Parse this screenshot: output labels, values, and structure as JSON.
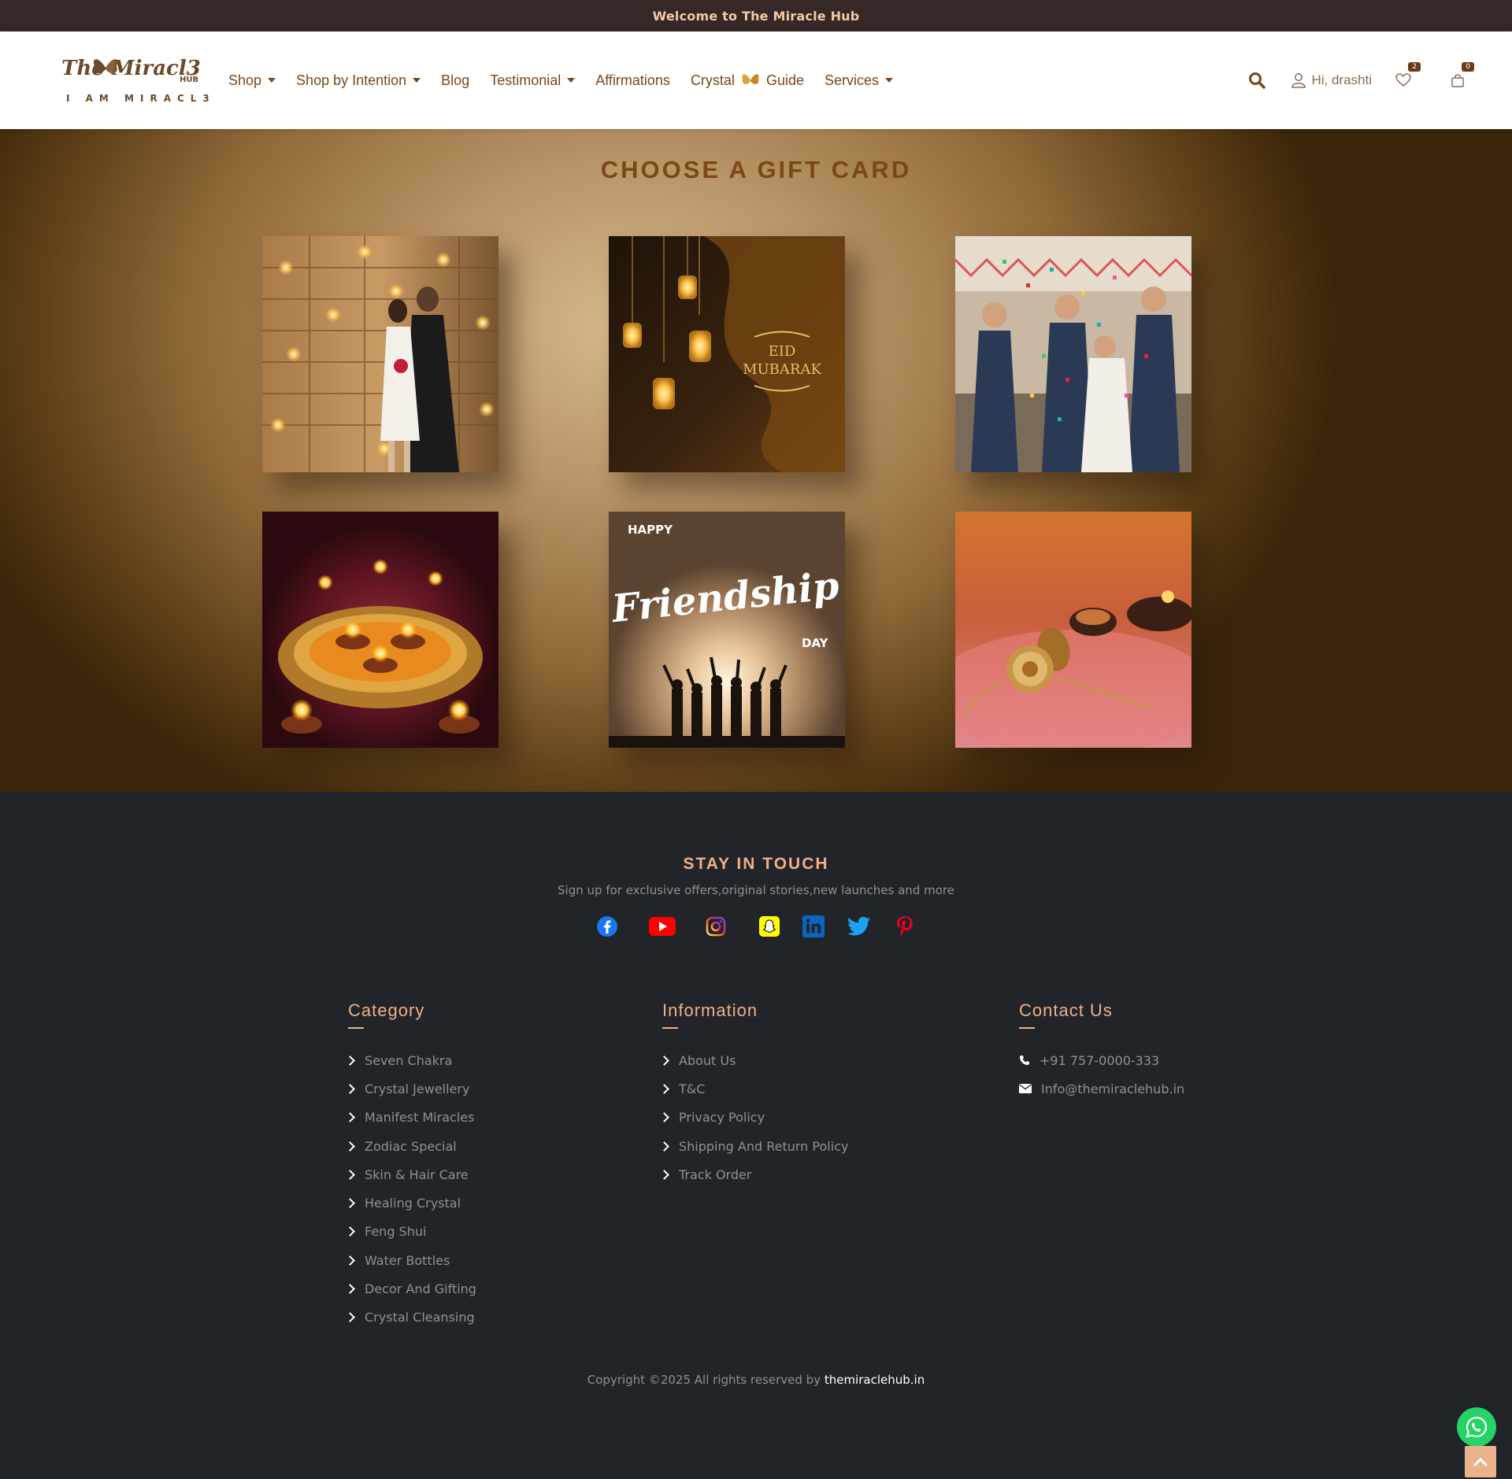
{
  "topbar": {
    "text": "Welcome to The Miracle Hub"
  },
  "brand": {
    "logo_script": "The Miracl3",
    "logo_hub": "HUB",
    "logo_tagline": "I AM MIRACL3"
  },
  "nav": [
    {
      "label": "Shop",
      "dropdown": true
    },
    {
      "label": "Shop by Intention",
      "dropdown": true
    },
    {
      "label": "Blog",
      "dropdown": false
    },
    {
      "label": "Testimonial",
      "dropdown": true
    },
    {
      "label": "Affirmations",
      "dropdown": false
    },
    {
      "label_before": "Crystal",
      "label_after": "Guide",
      "dropdown": false
    },
    {
      "label": "Services",
      "dropdown": true
    }
  ],
  "header": {
    "user_greeting": "Hi, drashti",
    "wishlist_count": "2",
    "cart_count": "0"
  },
  "gift": {
    "title": "CHOOSE A GIFT CARD",
    "cards": [
      {
        "theme": "couple-with-roses"
      },
      {
        "theme": "eid-mubarak",
        "text_line1": "EID",
        "text_line2": "MUBARAK"
      },
      {
        "theme": "party-confetti"
      },
      {
        "theme": "diwali-diyas"
      },
      {
        "theme": "friendship-day",
        "text_top": "HAPPY",
        "text_main": "Friendship",
        "text_bottom": "DAY"
      },
      {
        "theme": "rakhi"
      }
    ]
  },
  "footer": {
    "stay_title": "STAY IN TOUCH",
    "stay_sub": "Sign up for exclusive offers,original stories,new launches and more",
    "socials": [
      "facebook-icon",
      "youtube-icon",
      "instagram-icon",
      "snapchat-icon",
      "linkedin-icon",
      "twitter-icon",
      "pinterest-icon"
    ],
    "category_title": "Category",
    "categories": [
      "Seven Chakra",
      "Crystal Jewellery",
      "Manifest Miracles",
      "Zodiac Special",
      "Skin & Hair Care",
      "Healing Crystal",
      "Feng Shui",
      "Water Bottles",
      "Decor And Gifting",
      "Crystal Cleansing"
    ],
    "info_title": "Information",
    "info": [
      "About Us",
      "T&C",
      "Privacy Policy",
      "Shipping And Return Policy",
      "Track Order"
    ],
    "contact_title": "Contact Us",
    "phone": "+91 757-0000-333",
    "email": "Info@themiraclehub.in",
    "copyright": "Copyright ©2025 All rights reserved by",
    "copyright_link": "themiraclehub.in"
  },
  "colors": {
    "accent": "#7a4719",
    "footer_bg": "#212429",
    "footer_heading": "#f0b087",
    "topbar_bg": "#372828"
  }
}
